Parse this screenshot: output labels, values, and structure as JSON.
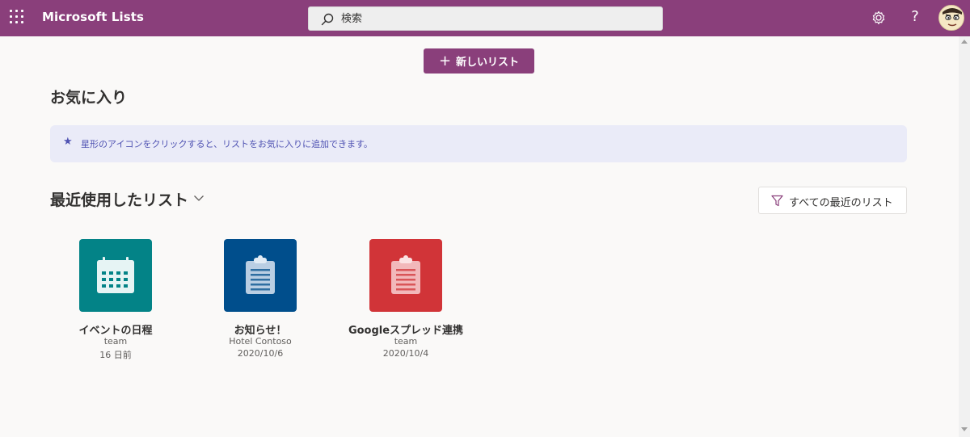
{
  "app": {
    "title": "Microsoft Lists",
    "brand_color": "#8a3f7b"
  },
  "header": {
    "search_placeholder": "検索",
    "icons": [
      "waffle-icon",
      "search-icon",
      "gear-icon",
      "help-icon",
      "avatar"
    ],
    "help_label": "?"
  },
  "toolbar": {
    "new_list_plus": "+",
    "new_list_label": "新しいリスト"
  },
  "favorites": {
    "heading": "お気に入り",
    "info_icon": "★",
    "info_text": "星形のアイコンをクリックすると、リストをお気に入りに追加できます。"
  },
  "recent": {
    "heading": "最近使用したリスト",
    "all_recent_label": "すべての最近のリスト",
    "lists": [
      {
        "title": "イベントの日程",
        "owner": "team",
        "date": "16 日前",
        "color": "#038387",
        "icon": "calendar-icon"
      },
      {
        "title": "お知らせ！",
        "owner": "Hotel Contoso",
        "date": "2020/10/6",
        "color": "#004e8c",
        "icon": "clipboard-icon"
      },
      {
        "title": "Googleスプレッド連携",
        "owner": "team",
        "date": "2020/10/4",
        "color": "#d13438",
        "icon": "clipboard-icon"
      }
    ]
  }
}
